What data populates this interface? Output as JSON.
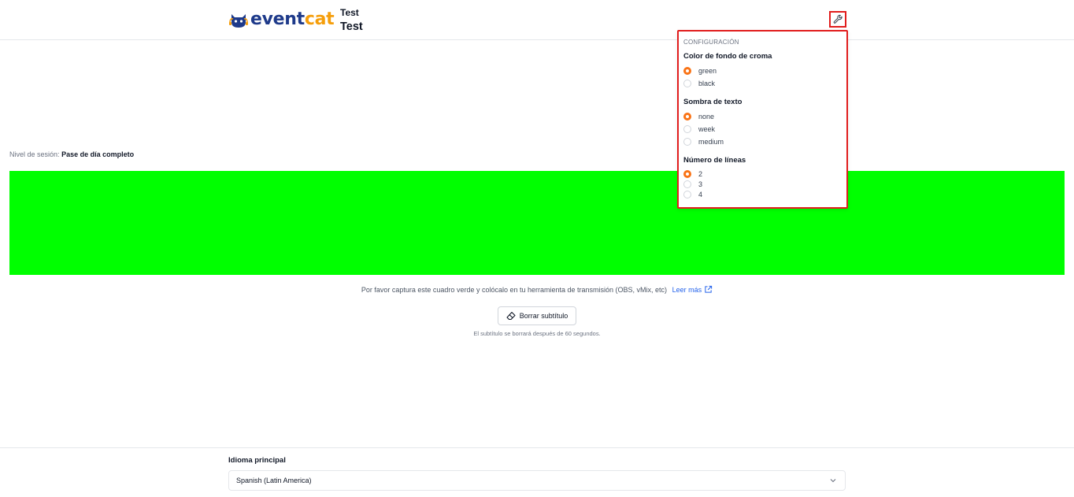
{
  "header": {
    "logo_text_part1": "event",
    "logo_text_part2": "cat",
    "event_name_line1": "Test",
    "event_name_line2": "Test",
    "settings_icon": "wrench-icon"
  },
  "settings_popover": {
    "heading": "CONFIGURACIÓN",
    "groups": [
      {
        "title": "Color de fondo de croma",
        "options": [
          {
            "label": "green",
            "checked": true
          },
          {
            "label": "black",
            "checked": false
          }
        ]
      },
      {
        "title": "Sombra de texto",
        "options": [
          {
            "label": "none",
            "checked": true
          },
          {
            "label": "week",
            "checked": false
          },
          {
            "label": "medium",
            "checked": false
          }
        ]
      },
      {
        "title": "Número de líneas",
        "options": [
          {
            "label": "2",
            "checked": true
          },
          {
            "label": "3",
            "checked": false
          },
          {
            "label": "4",
            "checked": false
          }
        ]
      }
    ]
  },
  "session": {
    "label": "Nivel de sesión:",
    "value": "Pase de día completo"
  },
  "chroma": {
    "color": "#00ff00"
  },
  "capture": {
    "note": "Por favor captura este cuadro verde y colócalo en tu herramienta de transmisión (OBS, vMix, etc)",
    "read_more": "Leer más",
    "clear_button": "Borrar subtítulo",
    "clear_note": "El subtítulo se borrará después de 60 segundos."
  },
  "footer": {
    "language_label": "Idioma principal",
    "language_value": "Spanish (Latin America)"
  },
  "colors": {
    "accent": "#f97316",
    "highlight": "#e11d1d",
    "link": "#2563eb",
    "brand_primary": "#1e3a8a",
    "brand_secondary": "#f59e0b"
  }
}
